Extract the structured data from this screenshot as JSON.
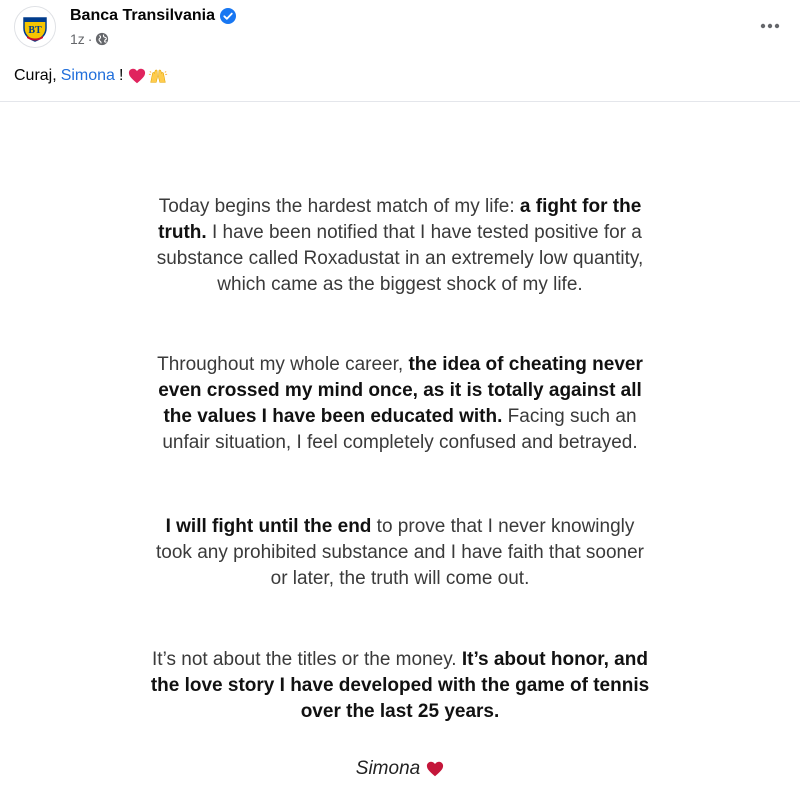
{
  "post": {
    "page_name": "Banca Transilvania",
    "timestamp": "1z",
    "separator": "·",
    "avatar_logo_text": "BT",
    "caption": {
      "prefix": "Curaj,",
      "mention": "Simona",
      "suffix": "!"
    }
  },
  "statement": {
    "p1": {
      "a": "Today begins the hardest match of my life: ",
      "b": "a fight for the truth.",
      "c": " I have been notified that I have tested positive for a substance called Roxadustat in an extremely low quantity, which came as the biggest shock of my life."
    },
    "p2": {
      "a": "Throughout my whole career, ",
      "b": "the idea of cheating never even crossed my mind once, as it is totally against all the values I have been educated with.",
      "c": " Facing such an unfair situation, I feel completely confused and betrayed."
    },
    "p3": {
      "b": "I will fight until the end",
      "c": " to prove that I never knowingly took any prohibited substance and I have faith that sooner or later, the truth will come out."
    },
    "p4": {
      "a": "It’s not about the titles or the money. ",
      "b": "It’s about honor, and the love story I have developed with the game of tennis over the last 25 years."
    },
    "signature": "Simona"
  },
  "icons": {
    "verified": "verified-badge-icon",
    "globe": "globe-icon",
    "more": "more-options-icon",
    "heart": "red-heart-emoji",
    "hands": "raising-hands-emoji"
  },
  "colors": {
    "mention": "#216fdb",
    "verified": "#1877f2",
    "heart": "#e0245e",
    "logo_blue": "#003c8c",
    "logo_gold": "#f6c500"
  }
}
